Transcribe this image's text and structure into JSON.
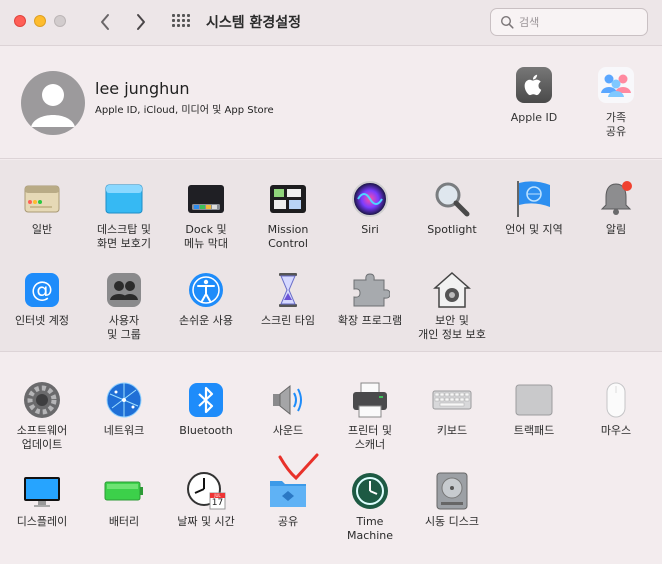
{
  "window": {
    "title": "시스템 환경설정"
  },
  "search": {
    "placeholder": "검색"
  },
  "account": {
    "name": "lee junghun",
    "subtitle": "Apple ID, iCloud, 미디어 및 App Store",
    "items": [
      {
        "label": "Apple ID"
      },
      {
        "label": "가족\n공유"
      }
    ]
  },
  "prefs_row1": [
    {
      "label": "일반",
      "icon": "general-icon"
    },
    {
      "label": "데스크탑 및\n화면 보호기",
      "icon": "desktop-icon"
    },
    {
      "label": "Dock 및\n메뉴 막대",
      "icon": "dock-icon"
    },
    {
      "label": "Mission\nControl",
      "icon": "mission-control-icon"
    },
    {
      "label": "Siri",
      "icon": "siri-icon"
    },
    {
      "label": "Spotlight",
      "icon": "spotlight-icon"
    },
    {
      "label": "언어 및 지역",
      "icon": "globe-flag-icon"
    },
    {
      "label": "알림",
      "icon": "bell-icon"
    }
  ],
  "prefs_row2": [
    {
      "label": "인터넷 계정",
      "icon": "at-icon"
    },
    {
      "label": "사용자\n및 그룹",
      "icon": "users-icon"
    },
    {
      "label": "손쉬운 사용",
      "icon": "accessibility-icon"
    },
    {
      "label": "스크린 타임",
      "icon": "hourglass-icon"
    },
    {
      "label": "확장 프로그램",
      "icon": "puzzle-icon"
    },
    {
      "label": "보안 및\n개인 정보 보호",
      "icon": "house-lock-icon"
    }
  ],
  "prefs_row3": [
    {
      "label": "소프트웨어\n업데이트",
      "icon": "gear-icon"
    },
    {
      "label": "네트워크",
      "icon": "network-globe-icon"
    },
    {
      "label": "Bluetooth",
      "icon": "bluetooth-icon"
    },
    {
      "label": "사운드",
      "icon": "speaker-icon"
    },
    {
      "label": "프린터 및\n스캐너",
      "icon": "printer-icon"
    },
    {
      "label": "키보드",
      "icon": "keyboard-icon"
    },
    {
      "label": "트랙패드",
      "icon": "trackpad-icon"
    },
    {
      "label": "마우스",
      "icon": "mouse-icon"
    }
  ],
  "prefs_row4": [
    {
      "label": "디스플레이",
      "icon": "display-icon"
    },
    {
      "label": "배터리",
      "icon": "battery-icon"
    },
    {
      "label": "날짜 및 시간",
      "icon": "clock-calendar-icon"
    },
    {
      "label": "공유",
      "icon": "sharing-folder-icon"
    },
    {
      "label": "Time\nMachine",
      "icon": "time-machine-icon"
    },
    {
      "label": "시동 디스크",
      "icon": "disk-icon"
    }
  ],
  "calendar": {
    "month": "JUL",
    "day": "17"
  },
  "colors": {
    "accent": "#1a82fb",
    "annotation": "#e8312a",
    "badge": "#f0412f"
  }
}
